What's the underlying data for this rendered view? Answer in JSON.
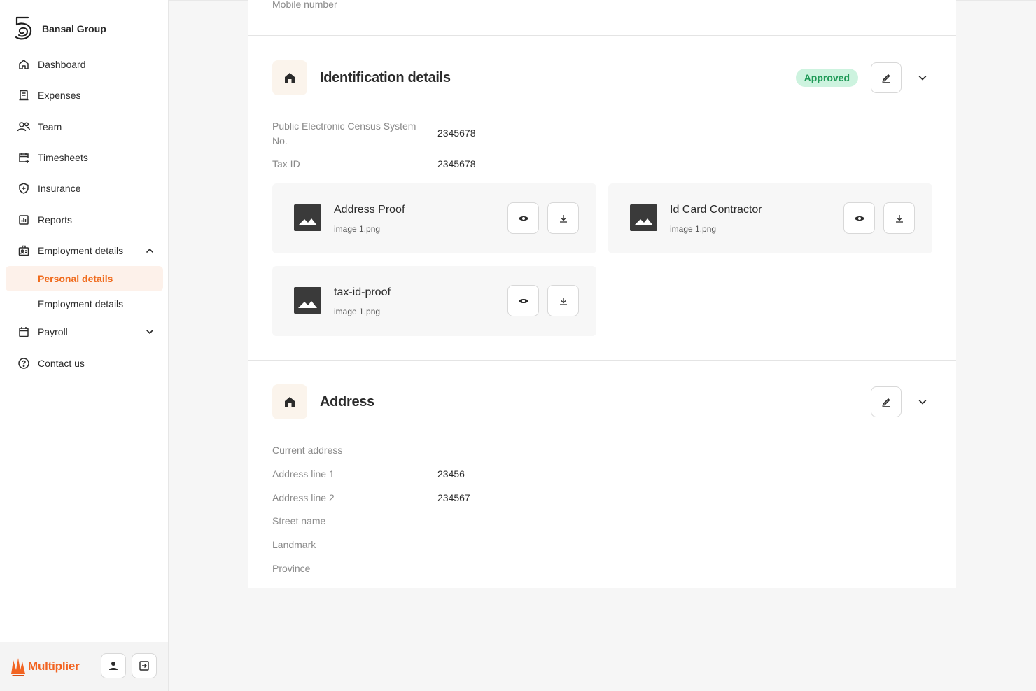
{
  "brand": {
    "name": "Bansal Group",
    "logo_icon": "five-swirl-logo-icon"
  },
  "sidebar": {
    "items": [
      {
        "label": "Dashboard",
        "icon": "home-icon"
      },
      {
        "label": "Expenses",
        "icon": "receipt-icon"
      },
      {
        "label": "Team",
        "icon": "people-icon"
      },
      {
        "label": "Timesheets",
        "icon": "calendar-plus-icon"
      },
      {
        "label": "Insurance",
        "icon": "shield-icon"
      },
      {
        "label": "Reports",
        "icon": "bar-chart-icon"
      },
      {
        "label": "Employment details",
        "icon": "id-badge-icon",
        "expanded": true
      },
      {
        "label": "Payroll",
        "icon": "calendar-icon",
        "expanded": false
      },
      {
        "label": "Contact us",
        "icon": "help-circle-icon"
      }
    ],
    "subitems": [
      {
        "label": "Personal details",
        "active": true
      },
      {
        "label": "Employment details",
        "active": false
      }
    ],
    "accent_color": "#f06a1b"
  },
  "footer": {
    "brand": "Multiplier",
    "brand_color": "#f26422"
  },
  "main": {
    "top_field_label": "Mobile number",
    "identification": {
      "title": "Identification details",
      "status": "Approved",
      "status_color": "#1f9a57",
      "fields": [
        {
          "label": "Public Electronic Census System No.",
          "value": "2345678"
        },
        {
          "label": "Tax ID",
          "value": "2345678"
        }
      ],
      "documents": [
        {
          "name": "Address Proof",
          "file": "image 1.png"
        },
        {
          "name": "Id Card Contractor",
          "file": "image 1.png"
        },
        {
          "name": "tax-id-proof",
          "file": "image 1.png"
        }
      ]
    },
    "address": {
      "title": "Address",
      "subheading": "Current address",
      "fields": [
        {
          "label": "Address line 1",
          "value": "23456"
        },
        {
          "label": "Address line 2",
          "value": "234567"
        },
        {
          "label": "Street name",
          "value": ""
        },
        {
          "label": "Landmark",
          "value": ""
        },
        {
          "label": "Province",
          "value": ""
        }
      ]
    }
  }
}
